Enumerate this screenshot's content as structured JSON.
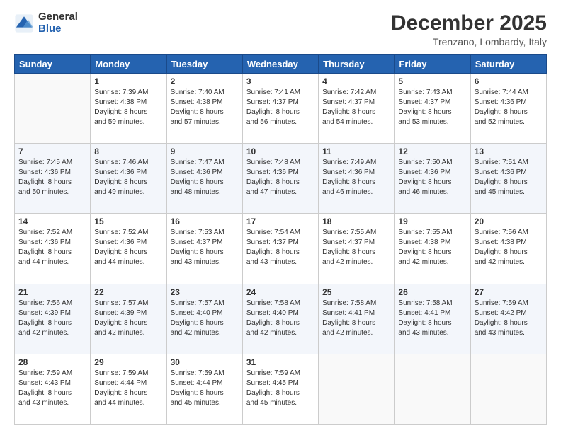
{
  "logo": {
    "general": "General",
    "blue": "Blue"
  },
  "header": {
    "month": "December 2025",
    "location": "Trenzano, Lombardy, Italy"
  },
  "days_of_week": [
    "Sunday",
    "Monday",
    "Tuesday",
    "Wednesday",
    "Thursday",
    "Friday",
    "Saturday"
  ],
  "weeks": [
    [
      {
        "day": "",
        "info": ""
      },
      {
        "day": "1",
        "info": "Sunrise: 7:39 AM\nSunset: 4:38 PM\nDaylight: 8 hours\nand 59 minutes."
      },
      {
        "day": "2",
        "info": "Sunrise: 7:40 AM\nSunset: 4:38 PM\nDaylight: 8 hours\nand 57 minutes."
      },
      {
        "day": "3",
        "info": "Sunrise: 7:41 AM\nSunset: 4:37 PM\nDaylight: 8 hours\nand 56 minutes."
      },
      {
        "day": "4",
        "info": "Sunrise: 7:42 AM\nSunset: 4:37 PM\nDaylight: 8 hours\nand 54 minutes."
      },
      {
        "day": "5",
        "info": "Sunrise: 7:43 AM\nSunset: 4:37 PM\nDaylight: 8 hours\nand 53 minutes."
      },
      {
        "day": "6",
        "info": "Sunrise: 7:44 AM\nSunset: 4:36 PM\nDaylight: 8 hours\nand 52 minutes."
      }
    ],
    [
      {
        "day": "7",
        "info": "Sunrise: 7:45 AM\nSunset: 4:36 PM\nDaylight: 8 hours\nand 50 minutes."
      },
      {
        "day": "8",
        "info": "Sunrise: 7:46 AM\nSunset: 4:36 PM\nDaylight: 8 hours\nand 49 minutes."
      },
      {
        "day": "9",
        "info": "Sunrise: 7:47 AM\nSunset: 4:36 PM\nDaylight: 8 hours\nand 48 minutes."
      },
      {
        "day": "10",
        "info": "Sunrise: 7:48 AM\nSunset: 4:36 PM\nDaylight: 8 hours\nand 47 minutes."
      },
      {
        "day": "11",
        "info": "Sunrise: 7:49 AM\nSunset: 4:36 PM\nDaylight: 8 hours\nand 46 minutes."
      },
      {
        "day": "12",
        "info": "Sunrise: 7:50 AM\nSunset: 4:36 PM\nDaylight: 8 hours\nand 46 minutes."
      },
      {
        "day": "13",
        "info": "Sunrise: 7:51 AM\nSunset: 4:36 PM\nDaylight: 8 hours\nand 45 minutes."
      }
    ],
    [
      {
        "day": "14",
        "info": "Sunrise: 7:52 AM\nSunset: 4:36 PM\nDaylight: 8 hours\nand 44 minutes."
      },
      {
        "day": "15",
        "info": "Sunrise: 7:52 AM\nSunset: 4:36 PM\nDaylight: 8 hours\nand 44 minutes."
      },
      {
        "day": "16",
        "info": "Sunrise: 7:53 AM\nSunset: 4:37 PM\nDaylight: 8 hours\nand 43 minutes."
      },
      {
        "day": "17",
        "info": "Sunrise: 7:54 AM\nSunset: 4:37 PM\nDaylight: 8 hours\nand 43 minutes."
      },
      {
        "day": "18",
        "info": "Sunrise: 7:55 AM\nSunset: 4:37 PM\nDaylight: 8 hours\nand 42 minutes."
      },
      {
        "day": "19",
        "info": "Sunrise: 7:55 AM\nSunset: 4:38 PM\nDaylight: 8 hours\nand 42 minutes."
      },
      {
        "day": "20",
        "info": "Sunrise: 7:56 AM\nSunset: 4:38 PM\nDaylight: 8 hours\nand 42 minutes."
      }
    ],
    [
      {
        "day": "21",
        "info": "Sunrise: 7:56 AM\nSunset: 4:39 PM\nDaylight: 8 hours\nand 42 minutes."
      },
      {
        "day": "22",
        "info": "Sunrise: 7:57 AM\nSunset: 4:39 PM\nDaylight: 8 hours\nand 42 minutes."
      },
      {
        "day": "23",
        "info": "Sunrise: 7:57 AM\nSunset: 4:40 PM\nDaylight: 8 hours\nand 42 minutes."
      },
      {
        "day": "24",
        "info": "Sunrise: 7:58 AM\nSunset: 4:40 PM\nDaylight: 8 hours\nand 42 minutes."
      },
      {
        "day": "25",
        "info": "Sunrise: 7:58 AM\nSunset: 4:41 PM\nDaylight: 8 hours\nand 42 minutes."
      },
      {
        "day": "26",
        "info": "Sunrise: 7:58 AM\nSunset: 4:41 PM\nDaylight: 8 hours\nand 43 minutes."
      },
      {
        "day": "27",
        "info": "Sunrise: 7:59 AM\nSunset: 4:42 PM\nDaylight: 8 hours\nand 43 minutes."
      }
    ],
    [
      {
        "day": "28",
        "info": "Sunrise: 7:59 AM\nSunset: 4:43 PM\nDaylight: 8 hours\nand 43 minutes."
      },
      {
        "day": "29",
        "info": "Sunrise: 7:59 AM\nSunset: 4:44 PM\nDaylight: 8 hours\nand 44 minutes."
      },
      {
        "day": "30",
        "info": "Sunrise: 7:59 AM\nSunset: 4:44 PM\nDaylight: 8 hours\nand 45 minutes."
      },
      {
        "day": "31",
        "info": "Sunrise: 7:59 AM\nSunset: 4:45 PM\nDaylight: 8 hours\nand 45 minutes."
      },
      {
        "day": "",
        "info": ""
      },
      {
        "day": "",
        "info": ""
      },
      {
        "day": "",
        "info": ""
      }
    ]
  ]
}
